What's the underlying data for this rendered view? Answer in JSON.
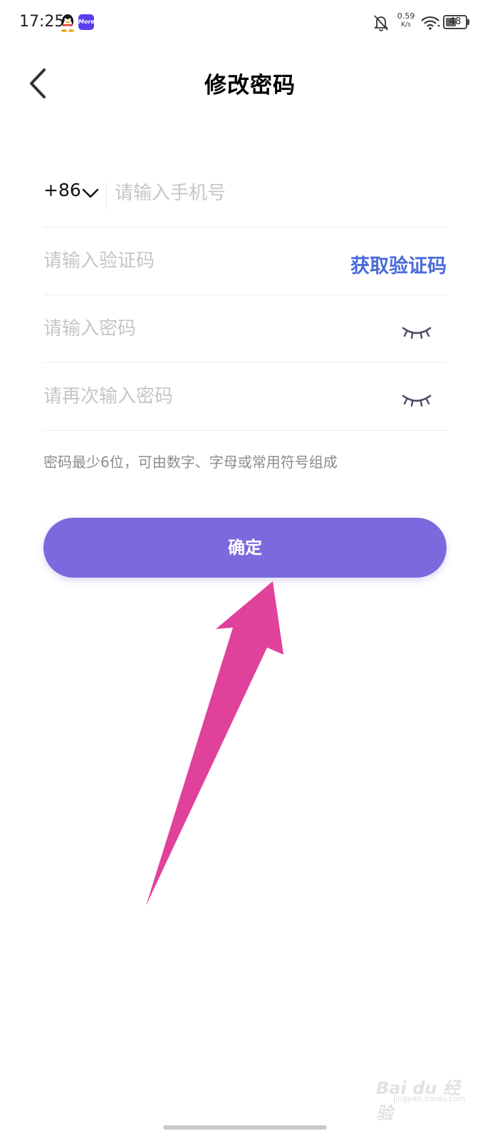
{
  "status_bar": {
    "time": "17:25",
    "app_badge": "More",
    "net_speed_value": "0.59",
    "net_speed_unit": "K/s",
    "battery": "48"
  },
  "header": {
    "title": "修改密码"
  },
  "form": {
    "country_code": "+86",
    "phone_placeholder": "请输入手机号",
    "code_placeholder": "请输入验证码",
    "get_code_label": "获取验证码",
    "password_placeholder": "请输入密码",
    "confirm_password_placeholder": "请再次输入密码",
    "hint": "密码最少6位，可由数字、字母或常用符号组成"
  },
  "confirm_button": {
    "label": "确定"
  },
  "watermark": {
    "brand": "Bai du 经验",
    "url": "jingyan.baidu.com"
  },
  "colors": {
    "primary": "#7b6ade",
    "link": "#4a6bd8",
    "annotation_arrow": "#e0419b",
    "placeholder": "#c6c6c6"
  }
}
